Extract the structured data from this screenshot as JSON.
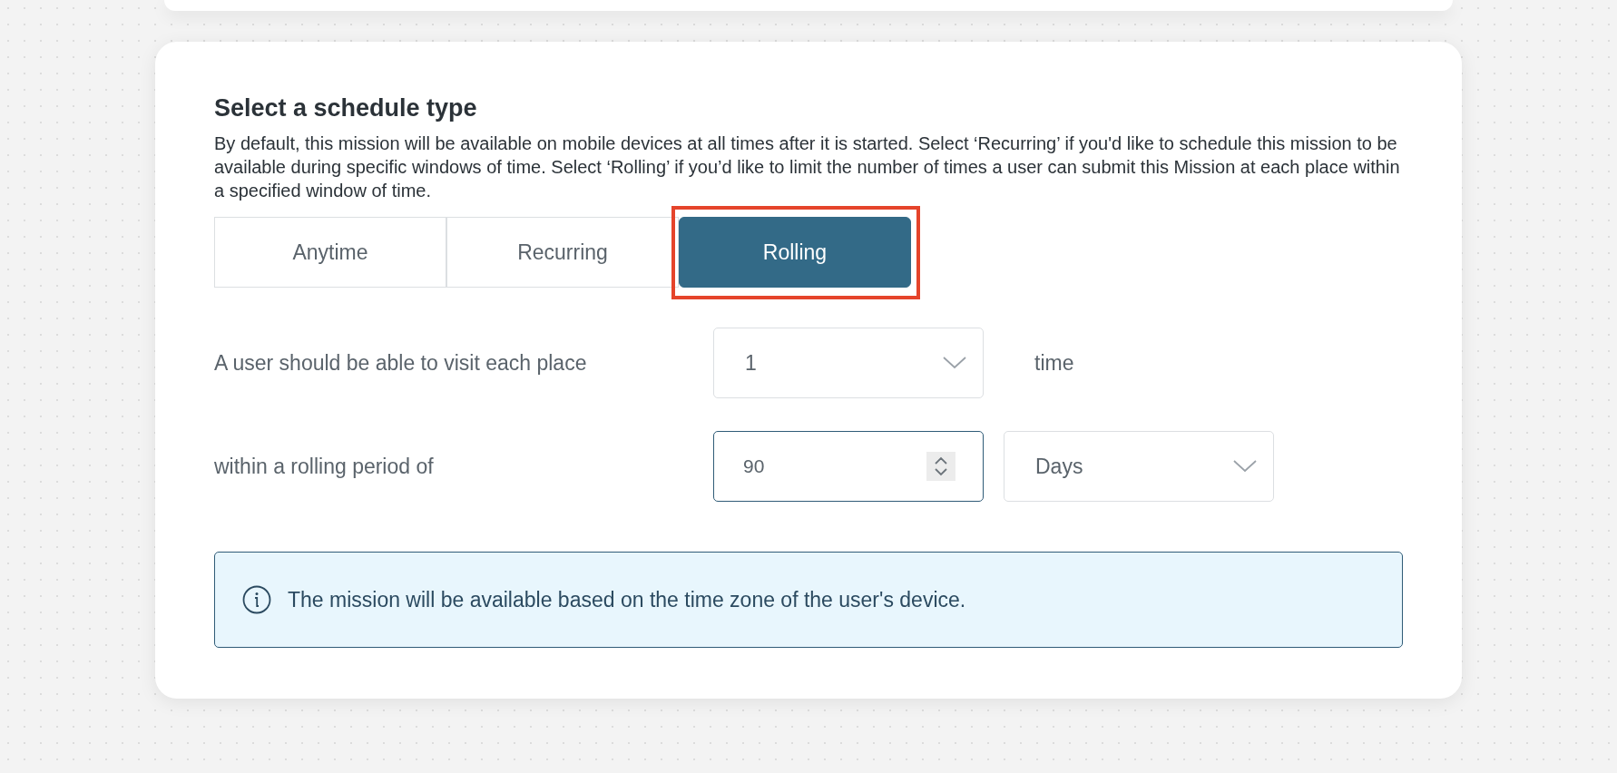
{
  "section": {
    "title": "Select a schedule type",
    "description": "By default, this mission will be available on mobile devices at all times after it is started. Select ‘Recurring’ if you'd like to schedule this mission to be available during specific windows of time. Select ‘Rolling’ if you’d like to limit the number of times a user can submit this Mission at each place within a specified window of time."
  },
  "tabs": [
    {
      "label": "Anytime",
      "selected": false,
      "highlighted": false
    },
    {
      "label": "Recurring",
      "selected": false,
      "highlighted": false
    },
    {
      "label": "Rolling",
      "selected": true,
      "highlighted": true
    }
  ],
  "visits": {
    "label": "A user should be able to visit each place",
    "value": "1",
    "unit": "time"
  },
  "period": {
    "label": "within a rolling period of",
    "value": "90",
    "unit": "Days"
  },
  "info": {
    "text": "The mission will be available based on the time zone of the user's device."
  }
}
